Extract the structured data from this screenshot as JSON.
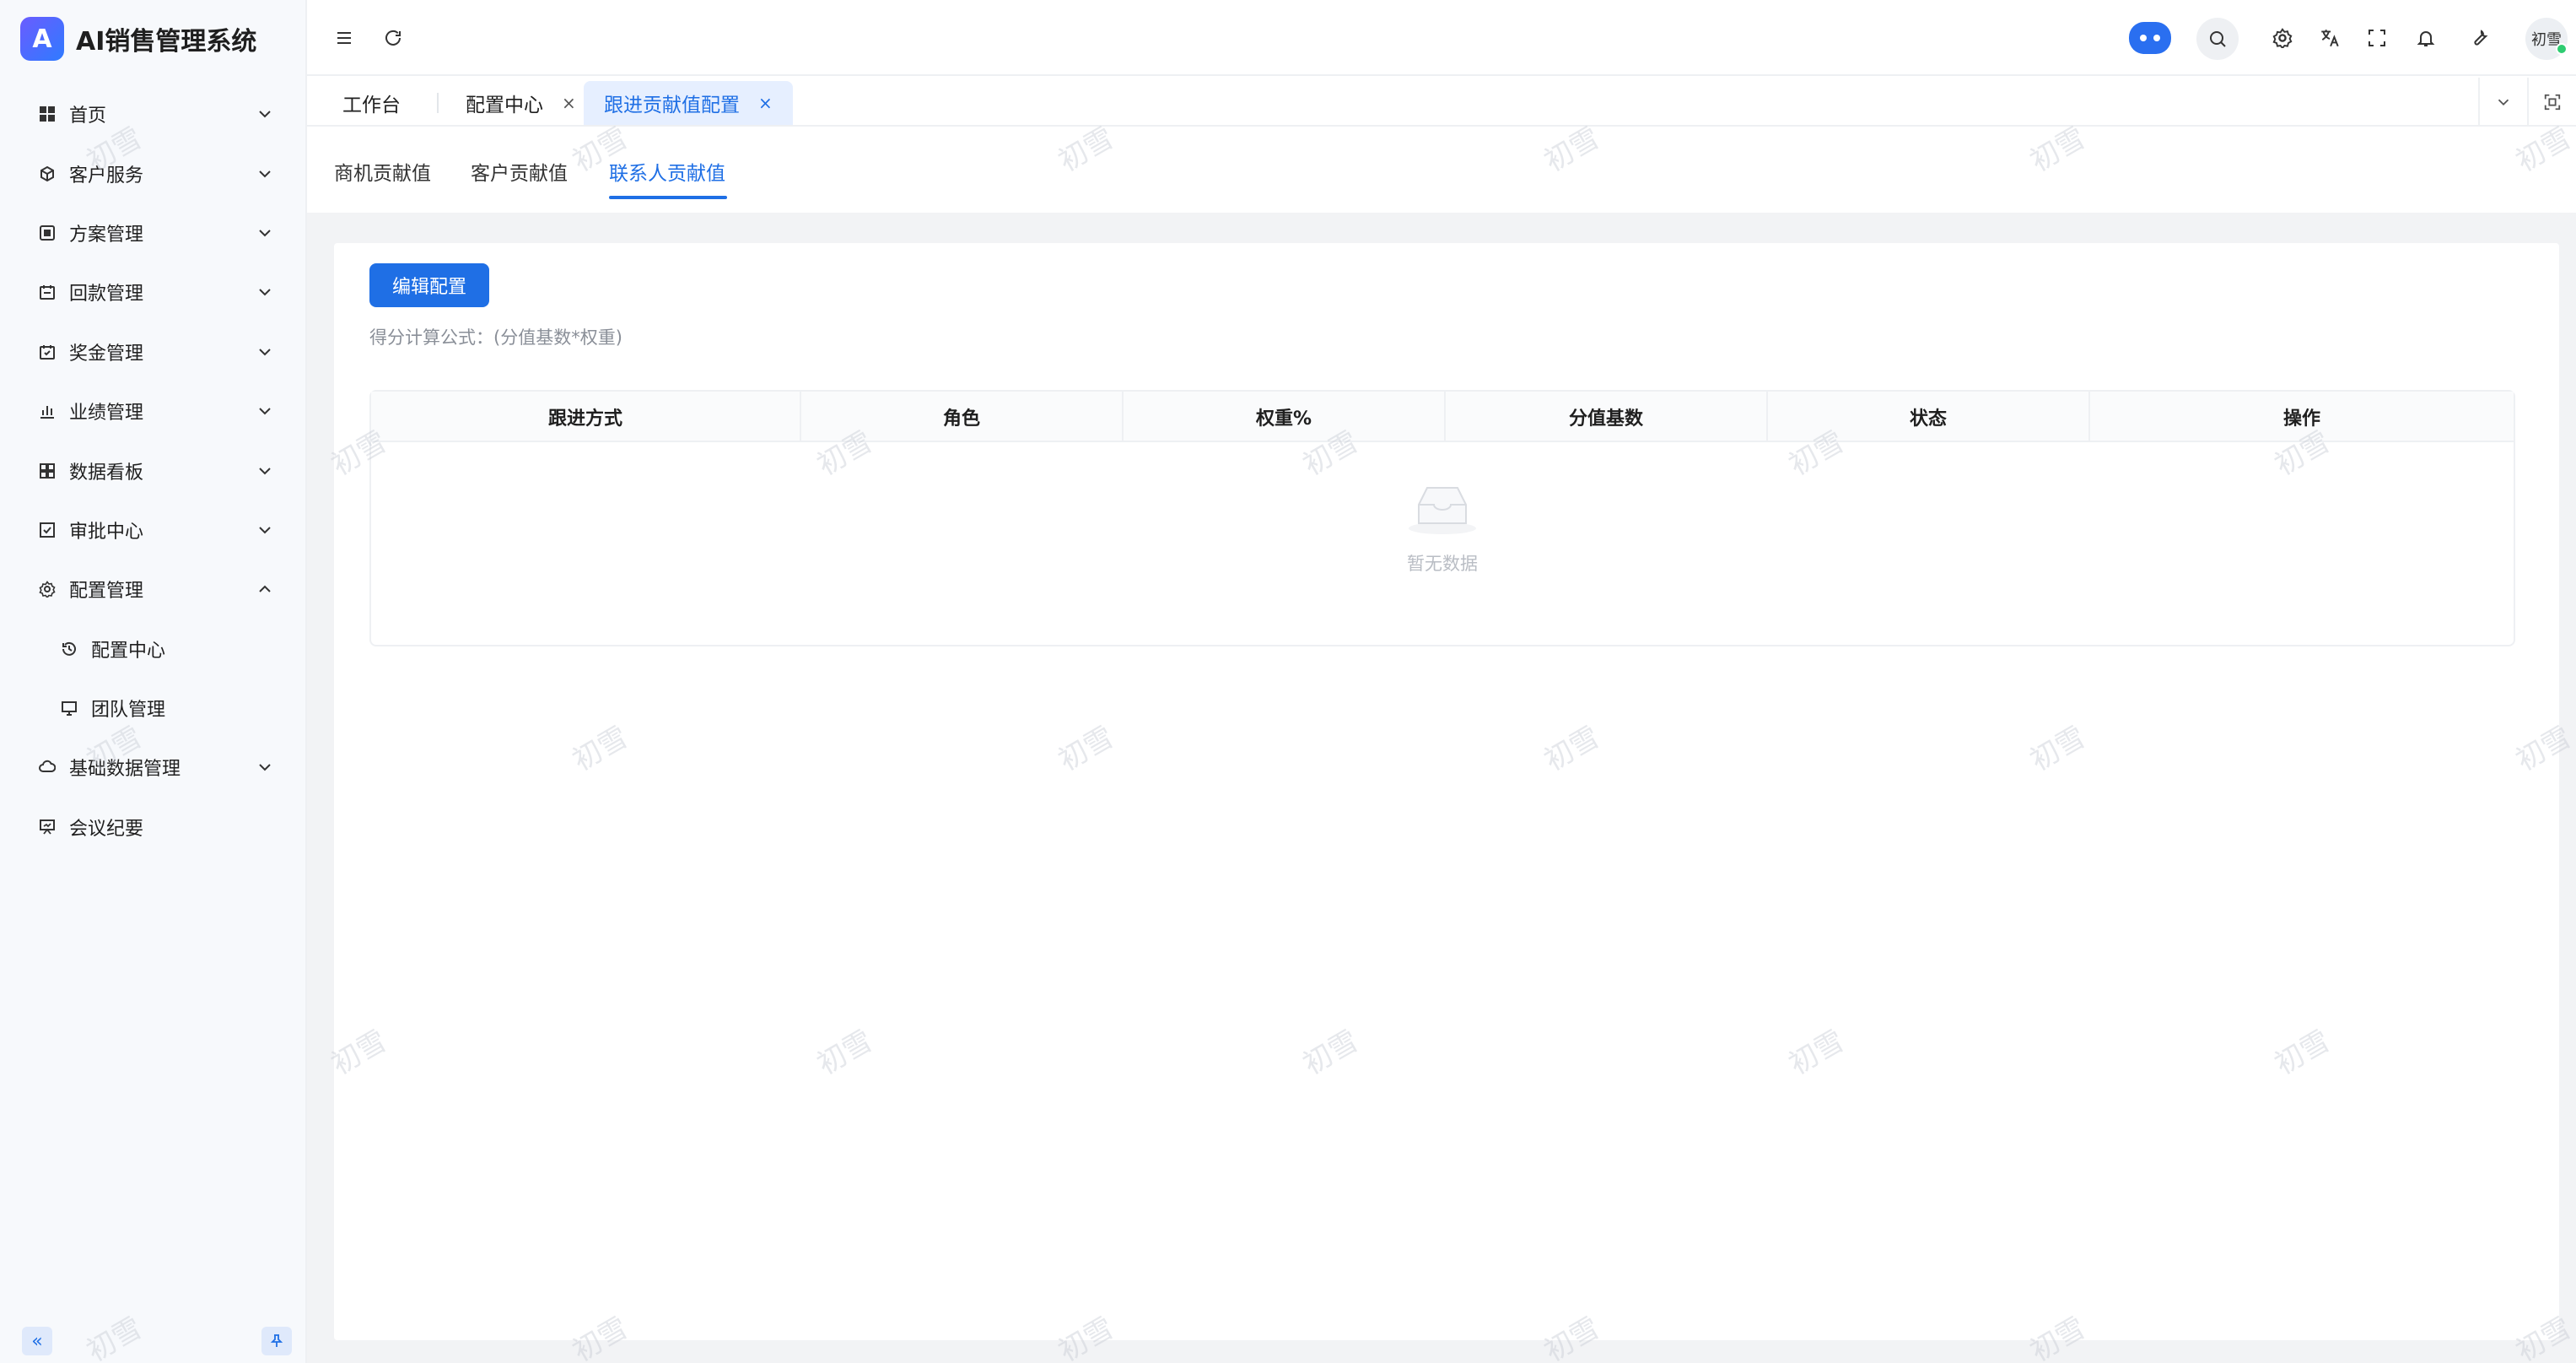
{
  "app": {
    "title": "AI销售管理系统",
    "logo_letter": "A"
  },
  "sidebar": {
    "items": [
      {
        "label": "首页",
        "icon": "grid-icon",
        "expandable": true,
        "expanded": false
      },
      {
        "label": "客户服务",
        "icon": "cube-icon",
        "expandable": true,
        "expanded": false
      },
      {
        "label": "方案管理",
        "icon": "box-icon",
        "expandable": true,
        "expanded": false
      },
      {
        "label": "回款管理",
        "icon": "calendar-icon",
        "expandable": true,
        "expanded": false
      },
      {
        "label": "奖金管理",
        "icon": "calendar-check-icon",
        "expandable": true,
        "expanded": false
      },
      {
        "label": "业绩管理",
        "icon": "bar-chart-icon",
        "expandable": true,
        "expanded": false
      },
      {
        "label": "数据看板",
        "icon": "dashboard-icon",
        "expandable": true,
        "expanded": false
      },
      {
        "label": "审批中心",
        "icon": "checkbox-icon",
        "expandable": true,
        "expanded": false
      },
      {
        "label": "配置管理",
        "icon": "gear-icon",
        "expandable": true,
        "expanded": true
      },
      {
        "label": "配置中心",
        "icon": "history-icon",
        "sub": true
      },
      {
        "label": "团队管理",
        "icon": "monitor-icon",
        "sub": true
      },
      {
        "label": "基础数据管理",
        "icon": "cloud-icon",
        "expandable": true,
        "expanded": false
      },
      {
        "label": "会议纪要",
        "icon": "presentation-icon",
        "expandable": false
      }
    ],
    "collapse_icon": "double-chevron-left-icon",
    "pin_icon": "pin-icon"
  },
  "header": {
    "user_name": "初雪",
    "icons": [
      "menu-icon",
      "refresh-icon",
      "robot-icon",
      "search-icon",
      "gear-icon",
      "translate-icon",
      "fullscreen-icon",
      "bell-icon",
      "wrench-icon"
    ]
  },
  "tabs": [
    {
      "label": "工作台",
      "closable": false,
      "active": false
    },
    {
      "label": "配置中心",
      "closable": true,
      "active": false
    },
    {
      "label": "跟进贡献值配置",
      "closable": true,
      "active": true
    }
  ],
  "subtabs": [
    {
      "label": "商机贡献值",
      "active": false
    },
    {
      "label": "客户贡献值",
      "active": false
    },
    {
      "label": "联系人贡献值",
      "active": true
    }
  ],
  "content": {
    "edit_button": "编辑配置",
    "formula": "得分计算公式：(分值基数*权重)",
    "table": {
      "columns": [
        "跟进方式",
        "角色",
        "权重%",
        "分值基数",
        "状态",
        "操作"
      ],
      "rows": [],
      "empty_text": "暂无数据"
    }
  },
  "watermark": "初雪",
  "colors": {
    "primary": "#1f6fe5",
    "sidebar_bg": "#f7f9fc",
    "content_bg": "#f2f3f5",
    "online": "#2ecc71"
  }
}
